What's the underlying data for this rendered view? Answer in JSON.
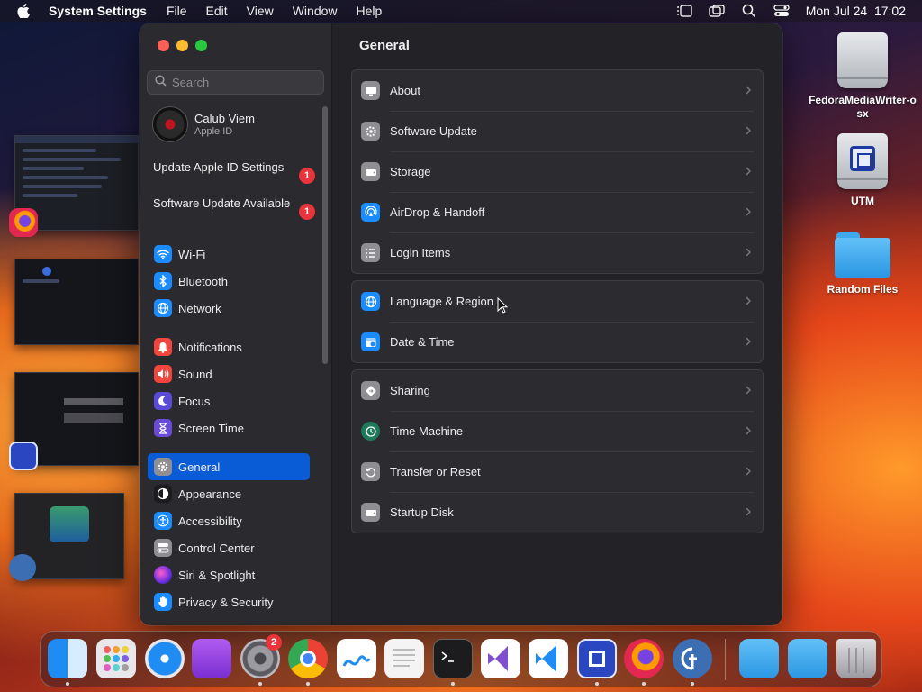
{
  "menubar": {
    "app_name": "System Settings",
    "menus": [
      "File",
      "Edit",
      "View",
      "Window",
      "Help"
    ],
    "clock": "Mon Jul 24  17:02"
  },
  "desktop": {
    "icons": [
      {
        "label": "FedoraMediaWriter-osx",
        "icon": "drive-icon"
      },
      {
        "label": "UTM",
        "icon": "utm-drive-icon"
      },
      {
        "label": "Random Files",
        "icon": "folder-icon"
      }
    ]
  },
  "window": {
    "search_placeholder": "Search",
    "account": {
      "name": "Calub Viem",
      "subtitle": "Apple ID"
    },
    "notices": [
      {
        "label": "Update Apple ID Settings",
        "badge": "1"
      },
      {
        "label": "Software Update Available",
        "badge": "1"
      }
    ],
    "sidebar_items": [
      {
        "label": "Wi-Fi",
        "icon": "wifi-icon",
        "color": "#1a8cff"
      },
      {
        "label": "Bluetooth",
        "icon": "bluetooth-icon",
        "color": "#1a8cff"
      },
      {
        "label": "Network",
        "icon": "globe-icon",
        "color": "#1a8cff"
      },
      {
        "label": "Notifications",
        "icon": "bell-icon",
        "color": "#f0463d"
      },
      {
        "label": "Sound",
        "icon": "speaker-icon",
        "color": "#f0463d"
      },
      {
        "label": "Focus",
        "icon": "moon-icon",
        "color": "#5a4bd6"
      },
      {
        "label": "Screen Time",
        "icon": "hourglass-icon",
        "color": "#6a4bd6"
      },
      {
        "label": "General",
        "icon": "gear-icon",
        "color": "#8e8e93",
        "selected": true
      },
      {
        "label": "Appearance",
        "icon": "appearance-icon",
        "color": "#1c1c1e"
      },
      {
        "label": "Accessibility",
        "icon": "accessibility-icon",
        "color": "#1a8cff"
      },
      {
        "label": "Control Center",
        "icon": "toggles-icon",
        "color": "#8e8e93"
      },
      {
        "label": "Siri & Spotlight",
        "icon": "siri-icon",
        "color": "#c040c0"
      },
      {
        "label": "Privacy & Security",
        "icon": "hand-icon",
        "color": "#1a8cff"
      }
    ],
    "content_title": "General",
    "groups": [
      [
        {
          "label": "About",
          "icon": "display-icon"
        },
        {
          "label": "Software Update",
          "icon": "gear-update-icon"
        },
        {
          "label": "Storage",
          "icon": "drive-icon"
        },
        {
          "label": "AirDrop & Handoff",
          "icon": "airdrop-icon"
        },
        {
          "label": "Login Items",
          "icon": "list-icon"
        }
      ],
      [
        {
          "label": "Language & Region",
          "icon": "globe-icon"
        },
        {
          "label": "Date & Time",
          "icon": "calendar-clock-icon"
        }
      ],
      [
        {
          "label": "Sharing",
          "icon": "sharing-icon"
        },
        {
          "label": "Time Machine",
          "icon": "time-machine-icon"
        },
        {
          "label": "Transfer or Reset",
          "icon": "reset-icon"
        },
        {
          "label": "Startup Disk",
          "icon": "drive-icon"
        }
      ]
    ]
  },
  "dock": {
    "apps": [
      "Finder",
      "Launchpad",
      "Safari",
      "Podcasts",
      "System Settings",
      "Chrome",
      "Freeform",
      "TextEdit",
      "Terminal",
      "Visual Studio",
      "VS Code",
      "UTM",
      "Firefox",
      "Fedora Media Writer",
      "Folder",
      "Folder",
      "Trash"
    ],
    "system_settings_badge": "2"
  }
}
